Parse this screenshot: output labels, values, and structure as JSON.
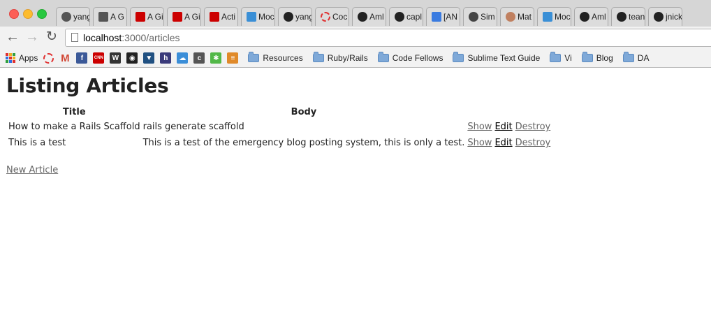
{
  "browser": {
    "tabs": [
      {
        "label": "yang",
        "icon": "github-icon",
        "color": "#555555"
      },
      {
        "label": "A G",
        "icon": "book-icon",
        "color": "#555555"
      },
      {
        "label": "A Gi",
        "icon": "rails-icon",
        "color": "#cc0000"
      },
      {
        "label": "A Gi",
        "icon": "rails-icon",
        "color": "#cc0000"
      },
      {
        "label": "Acti",
        "icon": "rails-icon",
        "color": "#cc0000"
      },
      {
        "label": "Moc",
        "icon": "mocha-icon",
        "color": "#3a8fd6"
      },
      {
        "label": "yang",
        "icon": "github-icon",
        "color": "#222222"
      },
      {
        "label": "Coc",
        "icon": "dashed-circle-icon",
        "color": "#e03030"
      },
      {
        "label": "Aml",
        "icon": "github-icon",
        "color": "#222222"
      },
      {
        "label": "capl",
        "icon": "github-icon",
        "color": "#222222"
      },
      {
        "label": "[AN",
        "icon": "chat-icon",
        "color": "#3a7be0"
      },
      {
        "label": "Sim",
        "icon": "gear-icon",
        "color": "#444444"
      },
      {
        "label": "Mat",
        "icon": "avatar-icon",
        "color": "#c08060"
      },
      {
        "label": "Moc",
        "icon": "mocha-icon",
        "color": "#3a8fd6"
      },
      {
        "label": "Aml",
        "icon": "github-icon",
        "color": "#222222"
      },
      {
        "label": "tean",
        "icon": "github-icon",
        "color": "#222222"
      },
      {
        "label": "jnick",
        "icon": "github-icon",
        "color": "#222222"
      }
    ],
    "url_host": "localhost",
    "url_path": ":3000/articles",
    "bookmarks": [
      {
        "label": "Apps",
        "icon": "apps-grid-icon"
      },
      {
        "label": "",
        "icon": "dashed-circle-icon",
        "color": "#e03030"
      },
      {
        "label": "",
        "icon": "gmail-icon",
        "color": "#d14836",
        "glyph": "M"
      },
      {
        "label": "",
        "icon": "facebook-icon",
        "color": "#3b5998",
        "glyph": "f"
      },
      {
        "label": "",
        "icon": "cnn-icon",
        "color": "#cc0000",
        "glyph": "CNN"
      },
      {
        "label": "",
        "icon": "wsj-icon",
        "color": "#333333",
        "glyph": "W"
      },
      {
        "label": "",
        "icon": "github-icon",
        "color": "#222222",
        "glyph": "◉"
      },
      {
        "label": "",
        "icon": "bitbucket-icon",
        "color": "#205081",
        "glyph": "▼"
      },
      {
        "label": "",
        "icon": "h-icon",
        "color": "#3a3a7a",
        "glyph": "h"
      },
      {
        "label": "",
        "icon": "cloud-icon",
        "color": "#3b8ed8",
        "glyph": "☁"
      },
      {
        "label": "",
        "icon": "c-icon",
        "color": "#555555",
        "glyph": "c"
      },
      {
        "label": "",
        "icon": "leaf-icon",
        "color": "#52b848",
        "glyph": "✱"
      },
      {
        "label": "",
        "icon": "stack-icon",
        "color": "#e08a2a",
        "glyph": "≡"
      },
      {
        "label": "Resources",
        "icon": "folder-icon"
      },
      {
        "label": "Ruby/Rails",
        "icon": "folder-icon"
      },
      {
        "label": "Code Fellows",
        "icon": "folder-icon"
      },
      {
        "label": "Sublime Text Guide",
        "icon": "folder-icon"
      },
      {
        "label": "Vi",
        "icon": "folder-icon"
      },
      {
        "label": "Blog",
        "icon": "folder-icon"
      },
      {
        "label": "DA",
        "icon": "folder-icon"
      }
    ]
  },
  "page": {
    "title": "Listing Articles",
    "columns": [
      "Title",
      "Body"
    ],
    "articles": [
      {
        "title": "How to make a Rails Scaffold",
        "body": "rails generate scaffold",
        "show": "Show",
        "edit": "Edit",
        "destroy": "Destroy"
      },
      {
        "title": "This is a test",
        "body": "This is a test of the emergency blog posting system, this is only a test.",
        "show": "Show",
        "edit": "Edit",
        "destroy": "Destroy"
      }
    ],
    "new_link": "New Article"
  }
}
